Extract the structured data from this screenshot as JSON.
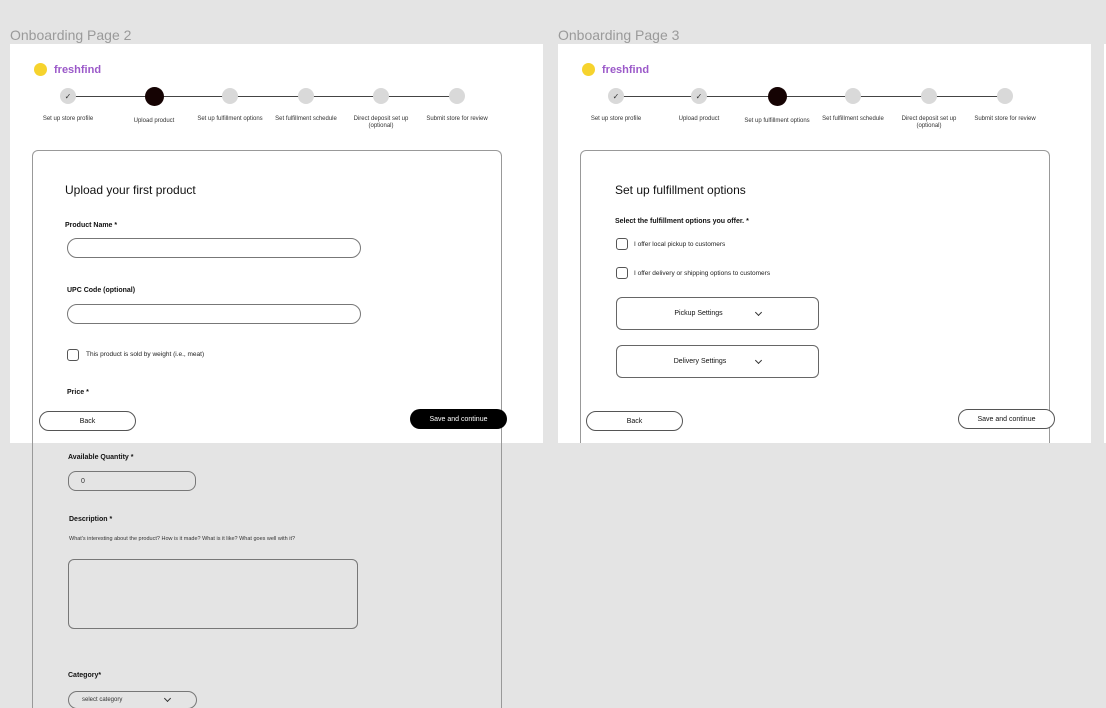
{
  "frames": {
    "page2_title": "Onboarding Page 2",
    "page3_title": "Onboarding Page 3"
  },
  "brand": {
    "name": "freshfind",
    "accent": "#9b59c9",
    "logo_color": "#f6d32d"
  },
  "steps": [
    {
      "label": "Set up store profile",
      "state": "done"
    },
    {
      "label": "Upload product",
      "state": "done"
    },
    {
      "label": "Set up fulfillment options",
      "state": "pending"
    },
    {
      "label": "Set fulfillment schedule",
      "state": "pending"
    },
    {
      "label": "Direct deposit set up (optional)",
      "state": "pending"
    },
    {
      "label": "Submit store for review",
      "state": "pending"
    }
  ],
  "check_glyph": "✓",
  "page2": {
    "heading": "Upload your first product",
    "product_name_label": "Product Name *",
    "upc_label": "UPC Code (optional)",
    "weight_checkbox_label": "This product is sold by weight (i.e., meat)",
    "price_label": "Price *",
    "back_label": "Back",
    "save_label": "Save and continue",
    "quantity_label": "Available Quantity *",
    "quantity_value": "0",
    "description_label": "Description *",
    "description_help": "What's interesting about the product? How is it made? What is it like? What goes well with it?",
    "category_label": "Category*",
    "category_value": "select category"
  },
  "page3": {
    "heading": "Set up fulfillment options",
    "options_label": "Select the fulfillment options you offer. *",
    "pickup_option": "I offer local pickup to customers",
    "delivery_option": "I offer delivery or shipping options to customers",
    "pickup_settings": "Pickup Settings",
    "delivery_settings": "Delivery Settings",
    "back_label": "Back",
    "save_label": "Save and continue"
  }
}
